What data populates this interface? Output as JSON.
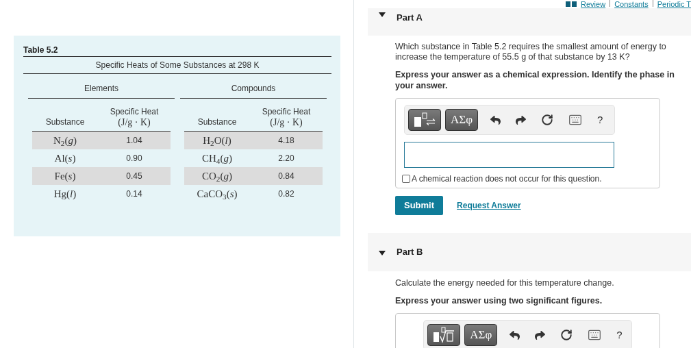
{
  "top_links": [
    "Review",
    "Constants",
    "Periodic T"
  ],
  "table": {
    "caption": "Table 5.2",
    "title": "Specific Heats of Some Substances at 298 K",
    "groups": [
      {
        "label": "Elements",
        "substance_header": "Substance",
        "heat_header": "Specific Heat",
        "unit_header": "(J/g · K)"
      },
      {
        "label": "Compounds",
        "substance_header": "Substance",
        "heat_header": "Specific Heat",
        "unit_header": "(J/g · K)"
      }
    ],
    "rows": [
      {
        "element": "N$_{2}$(*g*)",
        "element_heat": "1.04",
        "compound": "H$_{2}$O(*l*)",
        "compound_heat": "4.18"
      },
      {
        "element": "Al(*s*)",
        "element_heat": "0.90",
        "compound": "CH$_{4}$(*g*)",
        "compound_heat": "2.20"
      },
      {
        "element": "Fe(*s*)",
        "element_heat": "0.45",
        "compound": "CO$_{2}$(*g*)",
        "compound_heat": "0.84"
      },
      {
        "element": "Hg(*l*)",
        "element_heat": "0.14",
        "compound": "CaCO$_{3}$(*s*)",
        "compound_heat": "0.82"
      }
    ]
  },
  "parts": [
    {
      "label": "Part A",
      "expanded": true,
      "prompt": "Which substance in Table 5.2 requires the smallest amount of energy to increase the temperature of 55.5 g of that substance by 13 K?",
      "instruction": "Express your answer as a chemical expression. Identify the phase in your answer.",
      "toolbar": {
        "kind": "chemistry",
        "symbols": "ΑΣφ",
        "help": "?"
      },
      "answer_field": true,
      "checkbox": {
        "label": "A chemical reaction does not occur for this question.",
        "checked": false
      },
      "submit": "Submit",
      "request": "Request Answer"
    },
    {
      "label": "Part B",
      "expanded": true,
      "prompt": "Calculate the energy needed for this temperature change.",
      "instruction": "Express your answer using two significant figures.",
      "toolbar": {
        "kind": "math",
        "symbols": "ΑΣφ",
        "help": "?"
      }
    }
  ]
}
